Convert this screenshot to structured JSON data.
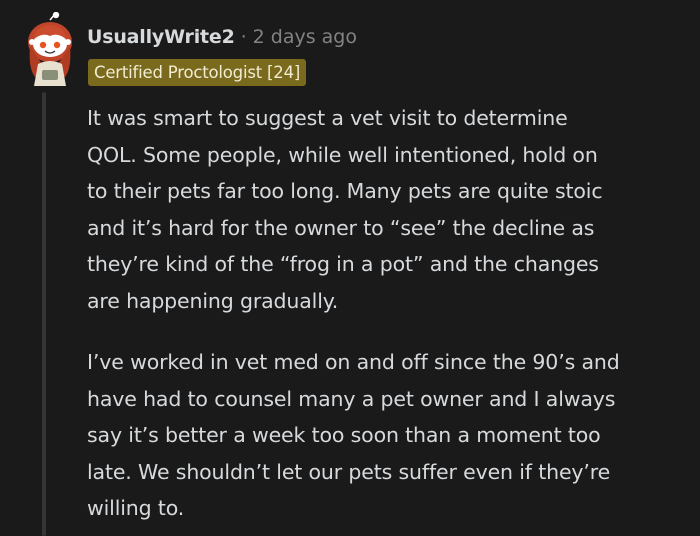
{
  "comment": {
    "author": "UsuallyWrite2",
    "separator": "·",
    "timestamp": "2 days ago",
    "flair": "Certified Proctologist [24]",
    "avatar_icon": "snoo-avatar-icon",
    "paragraphs": [
      "It was smart to suggest a vet visit to determine\nQOL. Some people, while well intentioned, hold on\nto their pets far too long. Many pets are quite stoic\nand it’s hard for the owner to “see” the decline as\nthey’re kind of the “frog in a pot” and the changes\nare happening gradually.",
      "I’ve worked in vet med on and off since the 90’s and\nhave had to counsel many a pet owner and I always\nsay it’s better a week too soon than a moment too\nlate. We shouldn’t let our pets suffer even if they’re\nwilling to."
    ]
  },
  "colors": {
    "background": "#1a1a1b",
    "text": "#d7dadc",
    "muted": "#818384",
    "flair_bg": "#7a6a1d",
    "thread_line": "#343536"
  }
}
